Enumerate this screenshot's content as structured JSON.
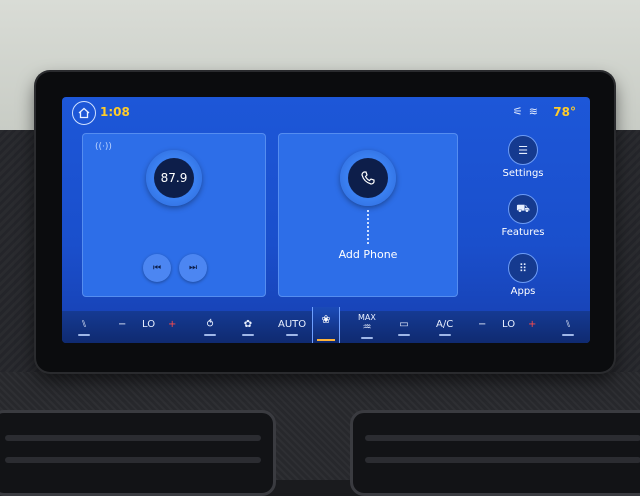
{
  "status_bar": {
    "time": "1:08",
    "temperature": "78°"
  },
  "radio_card": {
    "frequency": "87.9"
  },
  "phone_card": {
    "label": "Add Phone"
  },
  "side_menu": [
    {
      "label": "Settings",
      "icon": "sliders-icon"
    },
    {
      "label": "Features",
      "icon": "car-icon"
    },
    {
      "label": "Apps",
      "icon": "grid-icon"
    }
  ],
  "climate": {
    "driver_temp": "LO",
    "passenger_temp": "LO",
    "auto_label": "AUTO",
    "max_label": "MAX",
    "ac_label": "A/C",
    "minus": "−",
    "plus": "+"
  },
  "colors": {
    "accent_yellow": "#ffcc2a",
    "screen_blue": "#1d57d8",
    "card_blue": "#2d6ee8"
  }
}
